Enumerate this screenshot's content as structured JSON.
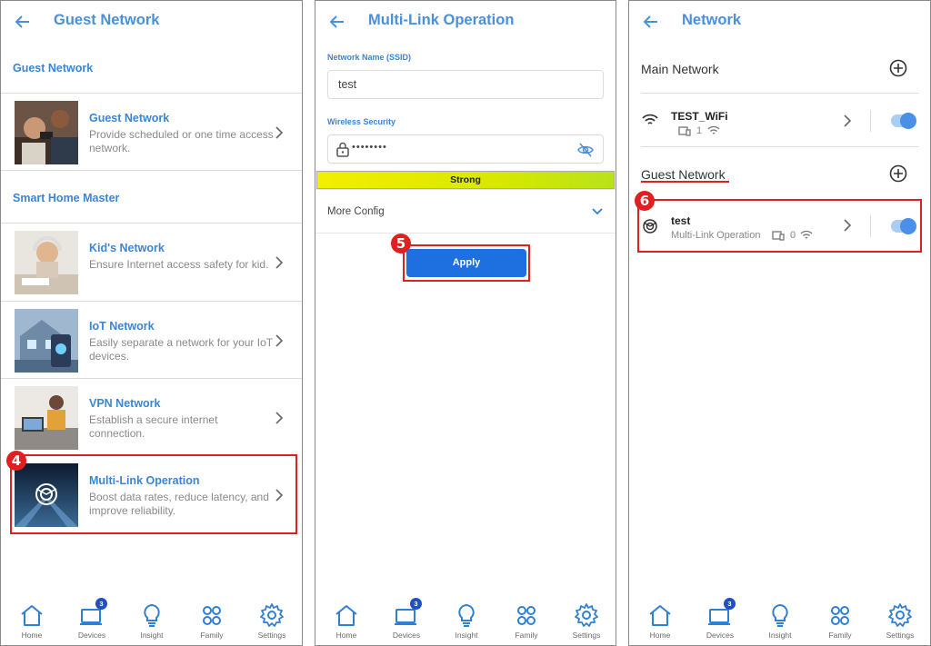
{
  "panel1": {
    "title": "Guest Network",
    "section_guest": "Guest Network",
    "section_smart": "Smart Home Master",
    "items": [
      {
        "title": "Guest Network",
        "desc": "Provide scheduled or one time access network."
      },
      {
        "title": "Kid's Network",
        "desc": "Ensure Internet access safety for kid."
      },
      {
        "title": "IoT Network",
        "desc": "Easily separate a network for your IoT devices."
      },
      {
        "title": "VPN Network",
        "desc": "Establish a secure internet connection."
      },
      {
        "title": "Multi-Link Operation",
        "desc": "Boost data rates, reduce latency, and improve reliability."
      }
    ],
    "callout_number": "4"
  },
  "panel2": {
    "title": "Multi-Link Operation",
    "ssid_label": "Network Name (SSID)",
    "ssid_value": "test",
    "security_label": "Wireless Security",
    "password_value": "••••••••",
    "strength": "Strong",
    "more_config": "More Config",
    "apply_label": "Apply",
    "callout_number": "5"
  },
  "panel3": {
    "title": "Network",
    "main_network_label": "Main Network",
    "main_network": {
      "name": "TEST_WiFi",
      "device_count": "1",
      "enabled": true
    },
    "guest_network_label": "Guest Network",
    "guest_network": {
      "name": "test",
      "type": "Multi-Link Operation",
      "device_count": "0",
      "enabled": true
    },
    "callout_number": "6"
  },
  "nav": {
    "items": [
      {
        "label": "Home",
        "icon": "house-icon"
      },
      {
        "label": "Devices",
        "icon": "devices-icon",
        "badge": "3"
      },
      {
        "label": "Insight",
        "icon": "lightbulb-icon"
      },
      {
        "label": "Family",
        "icon": "family-icon"
      },
      {
        "label": "Settings",
        "icon": "gear-icon"
      }
    ]
  },
  "colors": {
    "accent": "#3a86d6",
    "apply_button": "#1e6fe0",
    "callout": "#e02020",
    "toggle_on": "#4a90e8",
    "strength_bar": "#d8e800"
  }
}
